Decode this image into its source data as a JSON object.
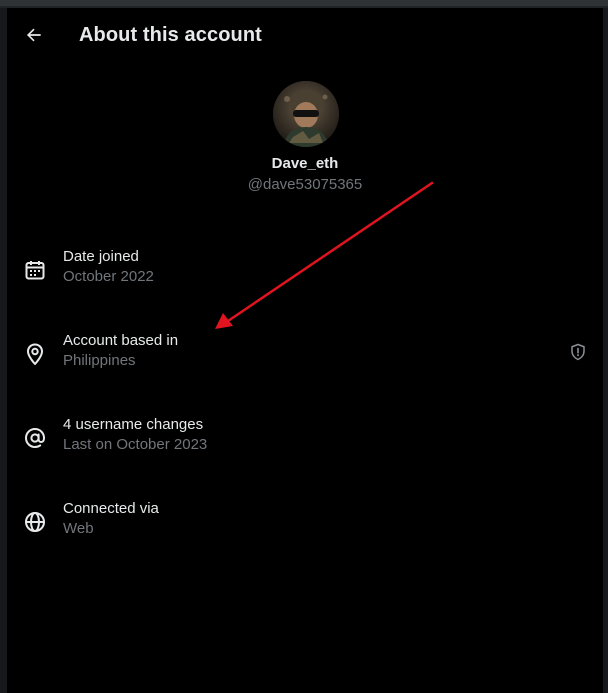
{
  "header": {
    "title": "About this account",
    "back_icon": "arrow-left-icon"
  },
  "profile": {
    "display_name": "Dave_eth",
    "handle": "@dave53075365",
    "avatar": "avatar-image"
  },
  "info": [
    {
      "label": "Date joined",
      "value": "October 2022",
      "icon": "calendar-icon"
    },
    {
      "label": "Account based in",
      "value": "Philippines",
      "icon": "location-pin-icon",
      "action_icon": "shield-alert-icon"
    },
    {
      "label": "4 username changes",
      "value": "Last on October 2023",
      "icon": "at-sign-icon"
    },
    {
      "label": "Connected via",
      "value": "Web",
      "icon": "globe-icon"
    }
  ],
  "colors": {
    "background": "#000000",
    "primary_text": "#e7e9ea",
    "secondary_text": "#71767b",
    "annotation_arrow": "#e0141e"
  }
}
